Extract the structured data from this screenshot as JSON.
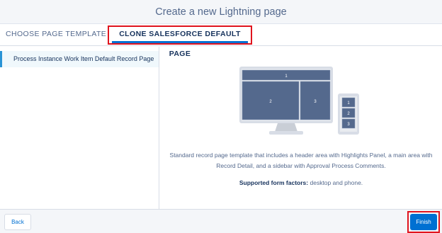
{
  "header": {
    "title": "Create a new Lightning page"
  },
  "tabs": [
    {
      "label": "CHOOSE PAGE TEMPLATE",
      "active": false
    },
    {
      "label": "CLONE SALESFORCE DEFAULT PAGE",
      "active": true
    }
  ],
  "sidebar": {
    "items": [
      {
        "label": "Process Instance Work Item Default Record Page",
        "selected": true
      }
    ]
  },
  "preview": {
    "desktop_regions": [
      "1",
      "2",
      "3"
    ],
    "phone_regions": [
      "1",
      "2",
      "3"
    ],
    "description": "Standard record page template that includes a header area with Highlights Panel, a main area with Record Detail, and a sidebar with Approval Process Comments.",
    "form_factors_label": "Supported form factors:",
    "form_factors_value": "desktop and phone."
  },
  "footer": {
    "back_label": "Back",
    "finish_label": "Finish"
  },
  "colors": {
    "accent": "#0070d2",
    "highlight": "#e0141e",
    "region": "#54698d"
  }
}
